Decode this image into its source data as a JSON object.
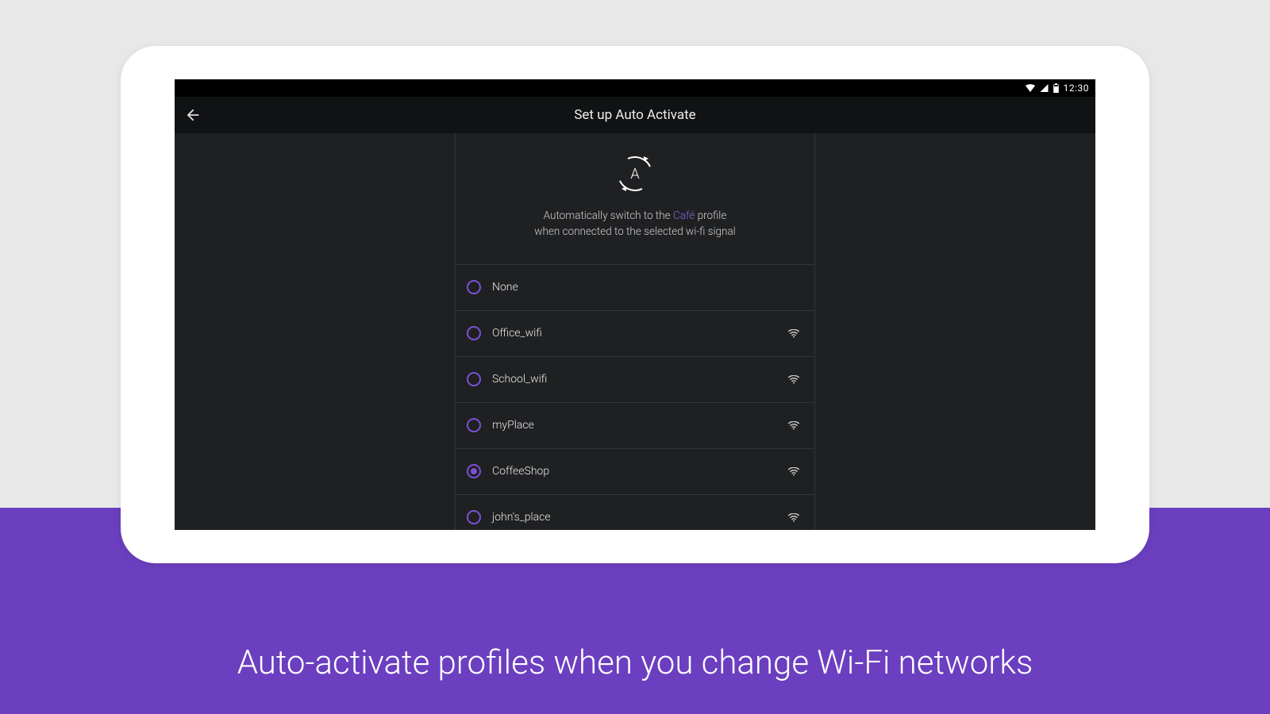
{
  "statusbar": {
    "time": "12:30"
  },
  "actionbar": {
    "title": "Set up Auto Activate"
  },
  "intro": {
    "line1_before": "Automatically switch to the ",
    "profile_name": "Café",
    "line1_after": " profile",
    "line2": "when connected to the selected wi-fi signal",
    "icon_letter": "A"
  },
  "networks": [
    {
      "label": "None",
      "has_wifi_icon": false,
      "selected": false
    },
    {
      "label": "Office_wifi",
      "has_wifi_icon": true,
      "selected": false
    },
    {
      "label": "School_wifi",
      "has_wifi_icon": true,
      "selected": false
    },
    {
      "label": "myPlace",
      "has_wifi_icon": true,
      "selected": false
    },
    {
      "label": "CoffeeShop",
      "has_wifi_icon": true,
      "selected": true
    },
    {
      "label": "john's_place",
      "has_wifi_icon": true,
      "selected": false
    }
  ],
  "caption": "Auto-activate profiles when you change Wi-Fi networks"
}
